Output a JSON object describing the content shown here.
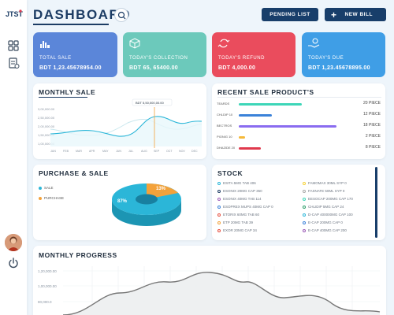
{
  "brand": {
    "logo_text": "JTST"
  },
  "header": {
    "title": "DASHBOARD"
  },
  "actions": {
    "pending_label": "PENDING LIST",
    "newbill_label": "NEW BILL"
  },
  "cards": [
    {
      "label": "TOTAL SALE",
      "value": "BDT 1,23.45678954.00",
      "color": "#5b86d9"
    },
    {
      "label": "TODAY'S COLLECTION",
      "value": "BDT 65, 65400.00",
      "color": "#6cc9bb"
    },
    {
      "label": "TODAY'S REFUND",
      "value": "BDT 4,000.00",
      "color": "#ea4c5d"
    },
    {
      "label": "TODAY'S DUE",
      "value": "BDT 1,23.45678895.00",
      "color": "#3f9ee6"
    }
  ],
  "monthly_sale": {
    "title": "MONTHLY SALE",
    "tooltip": "BDT 5,50,000,00.00",
    "y_ticks": [
      "3,00,000.00",
      "2,50,000.00",
      "2,00,000.00",
      "1,50,000.00",
      "1,00,000.00",
      "50,000.00"
    ],
    "months": [
      "JAN",
      "FEB",
      "MAR",
      "APR",
      "MAY",
      "JUN",
      "JUL",
      "AUG",
      "SEP",
      "OCT",
      "NOV",
      "DEC"
    ]
  },
  "recent_sale": {
    "title": "RECENT SALE PRODUCT'S",
    "items": [
      {
        "name": "TEARDS",
        "qty": "20 PIECE",
        "fraction": 0.55,
        "color": "#3dd6b8"
      },
      {
        "name": "CHLDIP 10",
        "qty": "12 PIECE",
        "fraction": 0.22,
        "color": "#3b82d9"
      },
      {
        "name": "BECTROS",
        "qty": "18 PIECE",
        "fraction": 0.78,
        "color": "#8a6cf0"
      },
      {
        "name": "PIONIG 10",
        "qty": "2 PIECE",
        "fraction": 0.05,
        "color": "#f5b93a"
      },
      {
        "name": "DHAZIDE 20",
        "qty": "8 PIECE",
        "fraction": 0.15,
        "color": "#e0394d"
      }
    ]
  },
  "purchase_sale": {
    "title": "PURCHASE & SALE",
    "legend": [
      {
        "label": "SALE",
        "color": "#2bb6d8"
      },
      {
        "label": "PURCHASE",
        "color": "#f4a23a"
      }
    ],
    "sale_pct": "87%",
    "purchase_pct": "13%"
  },
  "stock": {
    "title": "STOCK",
    "left": [
      {
        "name": "ESITA 5MG TAB 406",
        "color": "#2bb6d8"
      },
      {
        "name": "ESONIX 20MG CAP 350",
        "color": "#1c3c64"
      },
      {
        "name": "ESONIX 40MG TAB 114",
        "color": "#9b59b6"
      },
      {
        "name": "ESOPREX MUPS 40MG CAP 0",
        "color": "#3b82d9"
      },
      {
        "name": "ETORIX 60MG TAB 60",
        "color": "#e74c3c"
      },
      {
        "name": "ETP 20MG TAB 39",
        "color": "#f4a23a"
      },
      {
        "name": "EXOR 20MG CAP 34",
        "color": "#e74c3c"
      }
    ],
    "right": [
      {
        "name": "FAMOMAX 30ML SYP 0",
        "color": "#f5d33a"
      },
      {
        "name": "FASNATE 50ML SYP 0",
        "color": "#aaaaaa"
      },
      {
        "name": "EESOCAP 200MG CAP 170",
        "color": "#3dd6b8"
      },
      {
        "name": "CHLIDIP 5MG CAP 24",
        "color": "#2e9e6a"
      },
      {
        "name": "D-CAP 400000MG CAP 100",
        "color": "#2bb6d8"
      },
      {
        "name": "E-CAP 200MG CAP 0",
        "color": "#3b82d9"
      },
      {
        "name": "E-CAP 400MG CAP 200",
        "color": "#9b59b6"
      }
    ]
  },
  "monthly_progress": {
    "title": "MONTHLY PROGRESS",
    "y_ticks": [
      "1,20,000.00",
      "1,00,000.00",
      "80,000.0"
    ]
  }
}
